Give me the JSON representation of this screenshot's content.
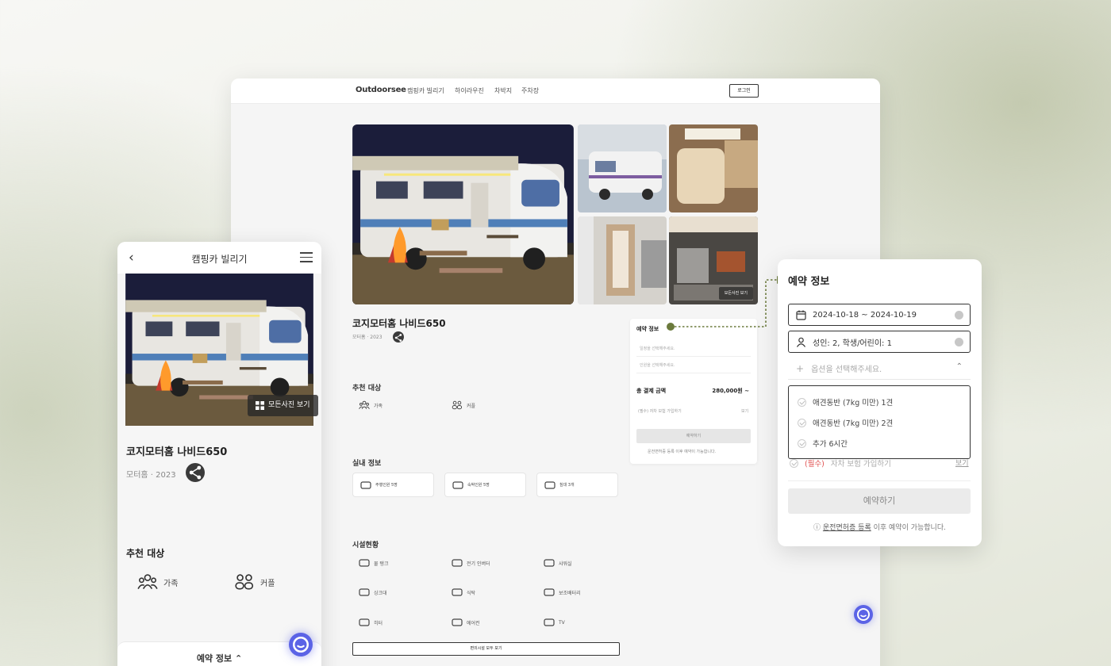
{
  "desktop": {
    "logo": "Outdoorsee",
    "nav": [
      "캠핑카 빌리기",
      "하이라우진",
      "차박지",
      "주차장"
    ],
    "login_label": "로그인",
    "photos_button": "모든사진 보기",
    "product_title": "코지모터홈 나비드650",
    "product_sub": "모터홈 · 2023",
    "recommend_heading": "추천 대상",
    "recommend": [
      "가족",
      "커플"
    ],
    "indoor_heading": "실내 정보",
    "indoor": [
      "주행인원 5명",
      "숙박인원 5명",
      "침대 3개"
    ],
    "facility_heading": "시설현황",
    "facilities": [
      "물 탱크",
      "전기 인버터",
      "샤워실",
      "싱크대",
      "식탁",
      "보조배터리",
      "히터",
      "에어컨",
      "TV"
    ],
    "facilities_all_button": "편의시설 모두 보기",
    "booking": {
      "label": "예약 정보",
      "date_placeholder": "일정을 선택해주세요.",
      "people_placeholder": "인원을 선택해주세요.",
      "total_label": "총 결제 금액",
      "total_value": "280,000원 ~",
      "insurance": "(필수) 자차 보험 가입하기",
      "insurance_view": "보기",
      "reserve": "예약하기",
      "note": "운전면허증 등록 이후 예약이 가능합니다."
    }
  },
  "mobile": {
    "title": "캠핑카 빌리기",
    "photos_button": "모든사진 보기",
    "product_title": "코지모터홈 나비드650",
    "product_sub": "모터홈 · 2023",
    "recommend_heading": "추천 대상",
    "recommend": [
      "가족",
      "커플"
    ],
    "footer": "예약 정보"
  },
  "popup": {
    "title": "예약 정보",
    "date_value": "2024-10-18 ~ 2024-10-19",
    "people_value": "성인: 2, 학생/어린이: 1",
    "option_placeholder": "옵션을 선택해주세요.",
    "options": [
      "애견동반 (7kg 미만) 1견",
      "애견동반 (7kg 미만) 2견",
      "추가 6시간"
    ],
    "insurance_required": "(필수)",
    "insurance_text": "자차 보험 가입하기",
    "insurance_view": "보기",
    "reserve": "예약하기",
    "note_link": "운전면허증 등록",
    "note_rest": " 이후 예약이 가능합니다."
  },
  "colors": {
    "accent": "#5b63e6",
    "connector": "#6b7a3c",
    "required": "#e0504f"
  }
}
